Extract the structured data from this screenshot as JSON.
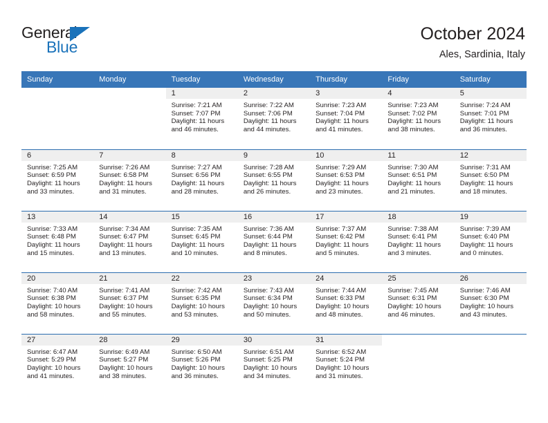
{
  "brand": {
    "name_part1": "General",
    "name_part2": "Blue",
    "accent_color": "#1a72ba",
    "triangle_icon": "triangle-icon"
  },
  "header": {
    "title": "October 2024",
    "subtitle": "Ales, Sardinia, Italy"
  },
  "calendar": {
    "header_bg": "#3876b8",
    "daynum_bg": "#efefef",
    "weekday_headers": [
      "Sunday",
      "Monday",
      "Tuesday",
      "Wednesday",
      "Thursday",
      "Friday",
      "Saturday"
    ],
    "labels": {
      "sunrise": "Sunrise:",
      "sunset": "Sunset:",
      "daylight": "Daylight:"
    },
    "weeks": [
      [
        {
          "day": "",
          "empty": true
        },
        {
          "day": "",
          "empty": true
        },
        {
          "day": "1",
          "sunrise": "Sunrise: 7:21 AM",
          "sunset": "Sunset: 7:07 PM",
          "daylight_l1": "Daylight: 11 hours",
          "daylight_l2": "and 46 minutes."
        },
        {
          "day": "2",
          "sunrise": "Sunrise: 7:22 AM",
          "sunset": "Sunset: 7:06 PM",
          "daylight_l1": "Daylight: 11 hours",
          "daylight_l2": "and 44 minutes."
        },
        {
          "day": "3",
          "sunrise": "Sunrise: 7:23 AM",
          "sunset": "Sunset: 7:04 PM",
          "daylight_l1": "Daylight: 11 hours",
          "daylight_l2": "and 41 minutes."
        },
        {
          "day": "4",
          "sunrise": "Sunrise: 7:23 AM",
          "sunset": "Sunset: 7:02 PM",
          "daylight_l1": "Daylight: 11 hours",
          "daylight_l2": "and 38 minutes."
        },
        {
          "day": "5",
          "sunrise": "Sunrise: 7:24 AM",
          "sunset": "Sunset: 7:01 PM",
          "daylight_l1": "Daylight: 11 hours",
          "daylight_l2": "and 36 minutes."
        }
      ],
      [
        {
          "day": "6",
          "sunrise": "Sunrise: 7:25 AM",
          "sunset": "Sunset: 6:59 PM",
          "daylight_l1": "Daylight: 11 hours",
          "daylight_l2": "and 33 minutes."
        },
        {
          "day": "7",
          "sunrise": "Sunrise: 7:26 AM",
          "sunset": "Sunset: 6:58 PM",
          "daylight_l1": "Daylight: 11 hours",
          "daylight_l2": "and 31 minutes."
        },
        {
          "day": "8",
          "sunrise": "Sunrise: 7:27 AM",
          "sunset": "Sunset: 6:56 PM",
          "daylight_l1": "Daylight: 11 hours",
          "daylight_l2": "and 28 minutes."
        },
        {
          "day": "9",
          "sunrise": "Sunrise: 7:28 AM",
          "sunset": "Sunset: 6:55 PM",
          "daylight_l1": "Daylight: 11 hours",
          "daylight_l2": "and 26 minutes."
        },
        {
          "day": "10",
          "sunrise": "Sunrise: 7:29 AM",
          "sunset": "Sunset: 6:53 PM",
          "daylight_l1": "Daylight: 11 hours",
          "daylight_l2": "and 23 minutes."
        },
        {
          "day": "11",
          "sunrise": "Sunrise: 7:30 AM",
          "sunset": "Sunset: 6:51 PM",
          "daylight_l1": "Daylight: 11 hours",
          "daylight_l2": "and 21 minutes."
        },
        {
          "day": "12",
          "sunrise": "Sunrise: 7:31 AM",
          "sunset": "Sunset: 6:50 PM",
          "daylight_l1": "Daylight: 11 hours",
          "daylight_l2": "and 18 minutes."
        }
      ],
      [
        {
          "day": "13",
          "sunrise": "Sunrise: 7:33 AM",
          "sunset": "Sunset: 6:48 PM",
          "daylight_l1": "Daylight: 11 hours",
          "daylight_l2": "and 15 minutes."
        },
        {
          "day": "14",
          "sunrise": "Sunrise: 7:34 AM",
          "sunset": "Sunset: 6:47 PM",
          "daylight_l1": "Daylight: 11 hours",
          "daylight_l2": "and 13 minutes."
        },
        {
          "day": "15",
          "sunrise": "Sunrise: 7:35 AM",
          "sunset": "Sunset: 6:45 PM",
          "daylight_l1": "Daylight: 11 hours",
          "daylight_l2": "and 10 minutes."
        },
        {
          "day": "16",
          "sunrise": "Sunrise: 7:36 AM",
          "sunset": "Sunset: 6:44 PM",
          "daylight_l1": "Daylight: 11 hours",
          "daylight_l2": "and 8 minutes."
        },
        {
          "day": "17",
          "sunrise": "Sunrise: 7:37 AM",
          "sunset": "Sunset: 6:42 PM",
          "daylight_l1": "Daylight: 11 hours",
          "daylight_l2": "and 5 minutes."
        },
        {
          "day": "18",
          "sunrise": "Sunrise: 7:38 AM",
          "sunset": "Sunset: 6:41 PM",
          "daylight_l1": "Daylight: 11 hours",
          "daylight_l2": "and 3 minutes."
        },
        {
          "day": "19",
          "sunrise": "Sunrise: 7:39 AM",
          "sunset": "Sunset: 6:40 PM",
          "daylight_l1": "Daylight: 11 hours",
          "daylight_l2": "and 0 minutes."
        }
      ],
      [
        {
          "day": "20",
          "sunrise": "Sunrise: 7:40 AM",
          "sunset": "Sunset: 6:38 PM",
          "daylight_l1": "Daylight: 10 hours",
          "daylight_l2": "and 58 minutes."
        },
        {
          "day": "21",
          "sunrise": "Sunrise: 7:41 AM",
          "sunset": "Sunset: 6:37 PM",
          "daylight_l1": "Daylight: 10 hours",
          "daylight_l2": "and 55 minutes."
        },
        {
          "day": "22",
          "sunrise": "Sunrise: 7:42 AM",
          "sunset": "Sunset: 6:35 PM",
          "daylight_l1": "Daylight: 10 hours",
          "daylight_l2": "and 53 minutes."
        },
        {
          "day": "23",
          "sunrise": "Sunrise: 7:43 AM",
          "sunset": "Sunset: 6:34 PM",
          "daylight_l1": "Daylight: 10 hours",
          "daylight_l2": "and 50 minutes."
        },
        {
          "day": "24",
          "sunrise": "Sunrise: 7:44 AM",
          "sunset": "Sunset: 6:33 PM",
          "daylight_l1": "Daylight: 10 hours",
          "daylight_l2": "and 48 minutes."
        },
        {
          "day": "25",
          "sunrise": "Sunrise: 7:45 AM",
          "sunset": "Sunset: 6:31 PM",
          "daylight_l1": "Daylight: 10 hours",
          "daylight_l2": "and 46 minutes."
        },
        {
          "day": "26",
          "sunrise": "Sunrise: 7:46 AM",
          "sunset": "Sunset: 6:30 PM",
          "daylight_l1": "Daylight: 10 hours",
          "daylight_l2": "and 43 minutes."
        }
      ],
      [
        {
          "day": "27",
          "sunrise": "Sunrise: 6:47 AM",
          "sunset": "Sunset: 5:29 PM",
          "daylight_l1": "Daylight: 10 hours",
          "daylight_l2": "and 41 minutes."
        },
        {
          "day": "28",
          "sunrise": "Sunrise: 6:49 AM",
          "sunset": "Sunset: 5:27 PM",
          "daylight_l1": "Daylight: 10 hours",
          "daylight_l2": "and 38 minutes."
        },
        {
          "day": "29",
          "sunrise": "Sunrise: 6:50 AM",
          "sunset": "Sunset: 5:26 PM",
          "daylight_l1": "Daylight: 10 hours",
          "daylight_l2": "and 36 minutes."
        },
        {
          "day": "30",
          "sunrise": "Sunrise: 6:51 AM",
          "sunset": "Sunset: 5:25 PM",
          "daylight_l1": "Daylight: 10 hours",
          "daylight_l2": "and 34 minutes."
        },
        {
          "day": "31",
          "sunrise": "Sunrise: 6:52 AM",
          "sunset": "Sunset: 5:24 PM",
          "daylight_l1": "Daylight: 10 hours",
          "daylight_l2": "and 31 minutes."
        },
        {
          "day": "",
          "empty": true
        },
        {
          "day": "",
          "empty": true
        }
      ]
    ]
  }
}
